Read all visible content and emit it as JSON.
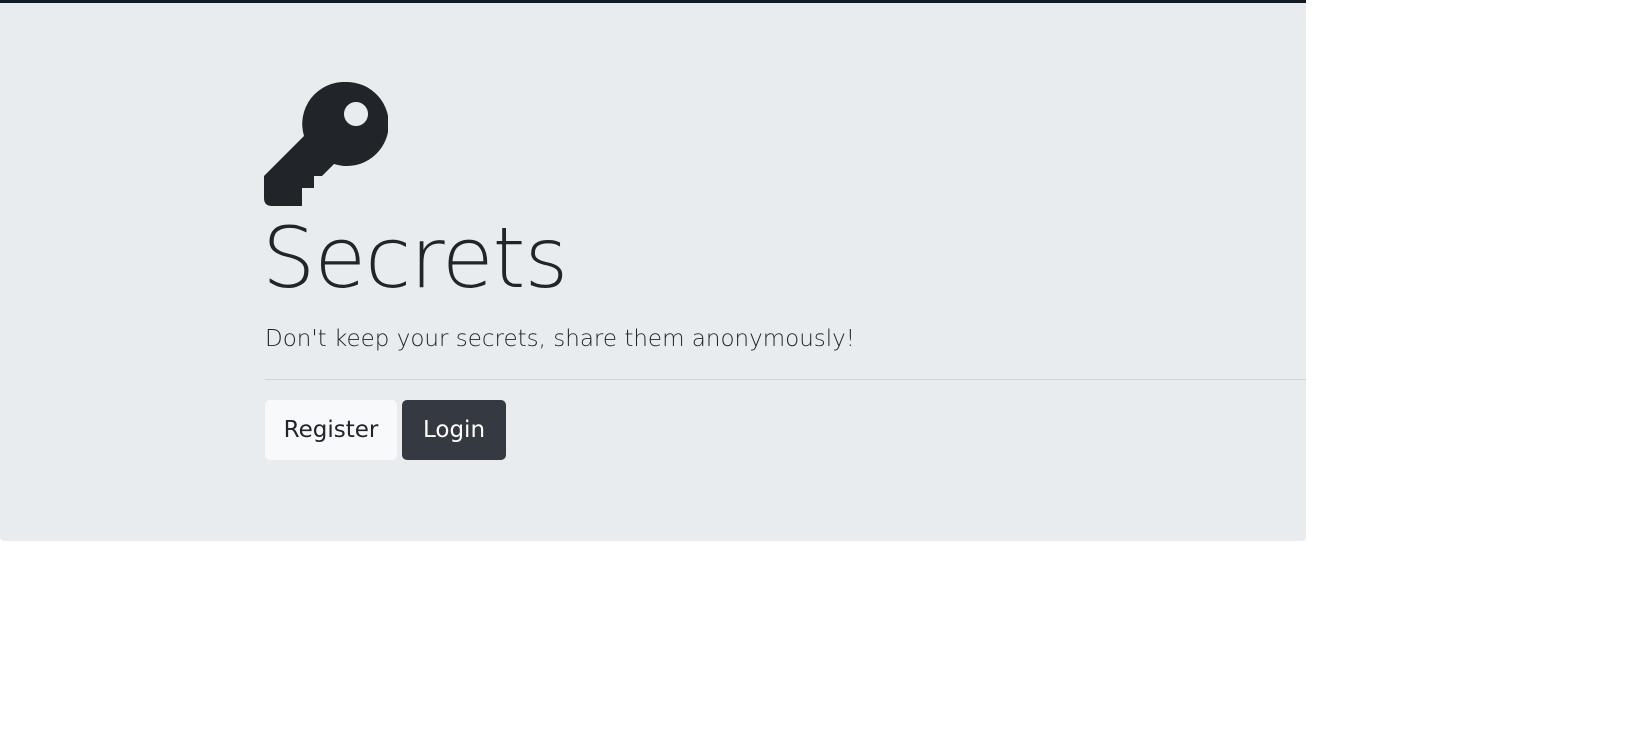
{
  "hero": {
    "icon": "key-icon",
    "title": "Secrets",
    "lead": "Don't keep your secrets, share them anonymously!"
  },
  "actions": {
    "register_label": "Register",
    "login_label": "Login"
  },
  "colors": {
    "background": "#e9ecef",
    "text": "#212529",
    "btn_light": "#f8f9fa",
    "btn_dark": "#343a40"
  }
}
